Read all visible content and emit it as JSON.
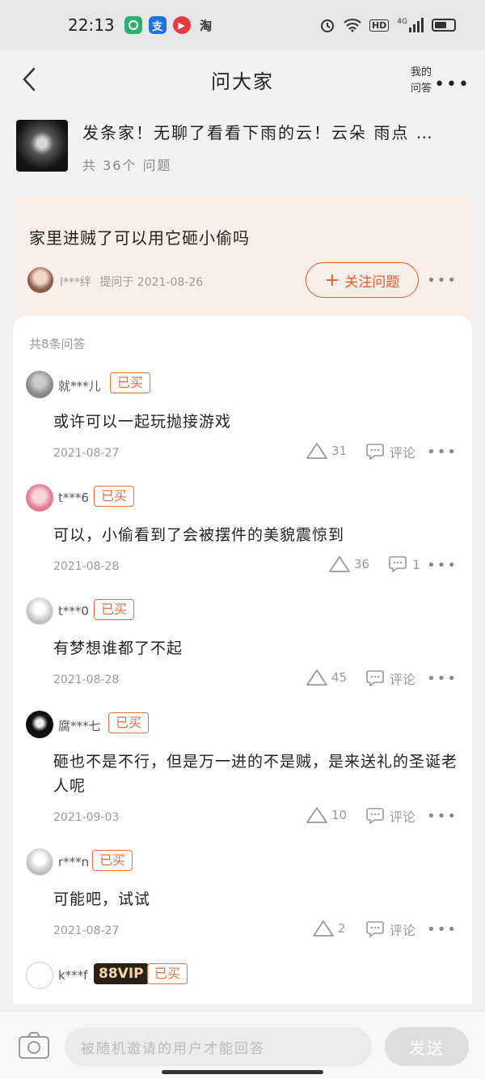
{
  "status_bar": {
    "time": "22:13",
    "apps": [
      {
        "name": "app-green",
        "label": "",
        "color": "#2bb36b"
      },
      {
        "name": "alipay",
        "label": "支",
        "color": "#1a73e8"
      },
      {
        "name": "video",
        "label": "▶",
        "color": "#e63946"
      },
      {
        "name": "taobao",
        "label": "淘",
        "color": "#e7e7e7"
      }
    ],
    "hd": "HD",
    "net": "4G"
  },
  "nav": {
    "title": "问大家",
    "my_answers": "我的问答"
  },
  "product": {
    "title": "发条家！无聊了看看下雨的云！云朵 雨点 …",
    "count": "共 36个 问题"
  },
  "question": {
    "text": "家里进贼了可以用它砸小偷吗",
    "asker": "l***绊",
    "asked_on": "提问于 2021-08-26",
    "follow_label": "关注问题"
  },
  "answers_panel": {
    "count_label": "共8条问答",
    "purchased_badge": "已买",
    "comment_label": "评论",
    "answers": [
      {
        "user": "就***儿",
        "text": "或许可以一起玩抛接游戏",
        "date": "2021-08-27",
        "likes": "31",
        "comments": "评论"
      },
      {
        "user": "t***6",
        "text": "可以，小偷看到了会被摆件的美貌震惊到",
        "date": "2021-08-28",
        "likes": "36",
        "comments": "1"
      },
      {
        "user": "t***0",
        "text": "有梦想谁都了不起",
        "date": "2021-08-28",
        "likes": "45",
        "comments": "评论"
      },
      {
        "user": "腐***七",
        "text": "砸也不是不行，但是万一进的不是贼，是来送礼的圣诞老人呢",
        "date": "2021-09-03",
        "likes": "10",
        "comments": "评论"
      },
      {
        "user": "r***n",
        "text": "可能吧，试试",
        "date": "2021-08-27",
        "likes": "2",
        "comments": "评论"
      },
      {
        "user": "k***f",
        "vip": "88VIP",
        "text": "",
        "date": "",
        "likes": "",
        "comments": ""
      }
    ]
  },
  "bottom": {
    "input_placeholder": "被随机邀请的用户才能回答",
    "send_label": "发送"
  },
  "colors": {
    "accent": "#e05e2a",
    "question_bg": "#fbede7",
    "page_bg": "#f2f2f2"
  }
}
